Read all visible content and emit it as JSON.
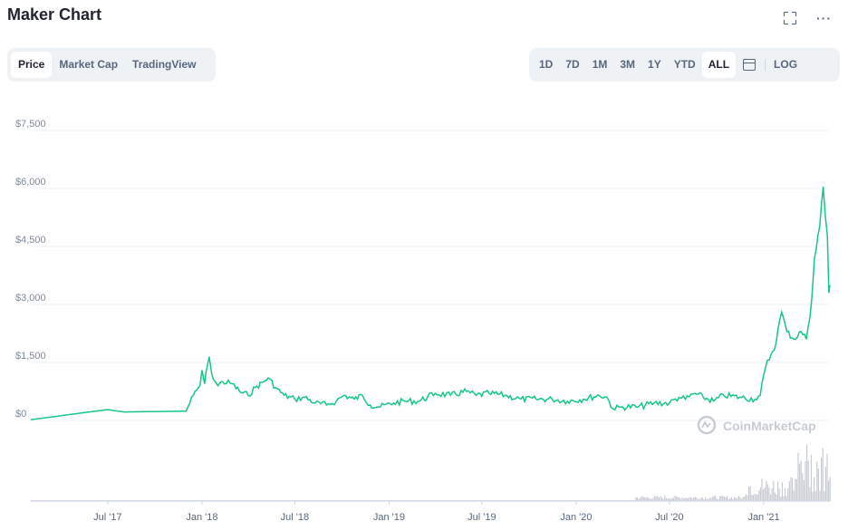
{
  "header": {
    "title": "Maker Chart"
  },
  "icons": {
    "expand": "expand-icon",
    "more": "more-icon",
    "calendar": "calendar-icon"
  },
  "tabs": [
    {
      "label": "Price",
      "active": true
    },
    {
      "label": "Market Cap",
      "active": false
    },
    {
      "label": "TradingView",
      "active": false
    }
  ],
  "ranges": [
    {
      "label": "1D",
      "active": false
    },
    {
      "label": "7D",
      "active": false
    },
    {
      "label": "1M",
      "active": false
    },
    {
      "label": "3M",
      "active": false
    },
    {
      "label": "1Y",
      "active": false
    },
    {
      "label": "YTD",
      "active": false
    },
    {
      "label": "ALL",
      "active": true
    }
  ],
  "log_label": "LOG",
  "watermark": "CoinMarketCap",
  "colors": {
    "line": "#16c784",
    "volume": "#c8ccd3",
    "grid": "#eff2f5"
  },
  "chart_data": {
    "type": "line",
    "title": "Maker Chart",
    "ylim": [
      0,
      7500
    ],
    "yticks": [
      "$7,500",
      "$6,000",
      "$4,500",
      "$3,000",
      "$1,500",
      "$0"
    ],
    "ytick_values": [
      7500,
      6000,
      4500,
      3000,
      1500,
      0
    ],
    "xticks": [
      "Jul '17",
      "Jan '18",
      "Jul '18",
      "Jan '19",
      "Jul '19",
      "Jan '20",
      "Jul '20",
      "Jan '21"
    ],
    "xlim": [
      "2017-02-01",
      "2021-05-10"
    ],
    "series": [
      {
        "points": [
          [
            "2017-02-01",
            20
          ],
          [
            "2017-06-01",
            230
          ],
          [
            "2017-07-01",
            280
          ],
          [
            "2017-08-01",
            220
          ],
          [
            "2017-10-01",
            230
          ],
          [
            "2017-12-01",
            240
          ],
          [
            "2017-12-15",
            650
          ],
          [
            "2017-12-28",
            900
          ],
          [
            "2018-01-01",
            1300
          ],
          [
            "2018-01-06",
            950
          ],
          [
            "2018-01-12",
            1450
          ],
          [
            "2018-01-15",
            1650
          ],
          [
            "2018-01-20",
            1200
          ],
          [
            "2018-02-01",
            900
          ],
          [
            "2018-02-10",
            1000
          ],
          [
            "2018-03-01",
            950
          ],
          [
            "2018-03-15",
            750
          ],
          [
            "2018-04-01",
            650
          ],
          [
            "2018-04-15",
            850
          ],
          [
            "2018-05-01",
            1000
          ],
          [
            "2018-05-10",
            1100
          ],
          [
            "2018-05-25",
            850
          ],
          [
            "2018-06-10",
            650
          ],
          [
            "2018-07-01",
            550
          ],
          [
            "2018-07-20",
            600
          ],
          [
            "2018-08-10",
            450
          ],
          [
            "2018-09-01",
            400
          ],
          [
            "2018-09-20",
            500
          ],
          [
            "2018-10-05",
            650
          ],
          [
            "2018-10-25",
            550
          ],
          [
            "2018-11-10",
            650
          ],
          [
            "2018-11-25",
            400
          ],
          [
            "2018-12-15",
            350
          ],
          [
            "2019-01-10",
            450
          ],
          [
            "2019-02-01",
            500
          ],
          [
            "2019-03-01",
            500
          ],
          [
            "2019-04-01",
            700
          ],
          [
            "2019-05-01",
            650
          ],
          [
            "2019-06-01",
            750
          ],
          [
            "2019-06-20",
            650
          ],
          [
            "2019-07-15",
            700
          ],
          [
            "2019-08-15",
            650
          ],
          [
            "2019-09-15",
            550
          ],
          [
            "2019-10-15",
            550
          ],
          [
            "2019-11-15",
            550
          ],
          [
            "2019-12-15",
            500
          ],
          [
            "2020-01-15",
            550
          ],
          [
            "2020-02-15",
            650
          ],
          [
            "2020-03-01",
            600
          ],
          [
            "2020-03-13",
            300
          ],
          [
            "2020-04-01",
            350
          ],
          [
            "2020-05-01",
            350
          ],
          [
            "2020-06-01",
            450
          ],
          [
            "2020-07-01",
            450
          ],
          [
            "2020-07-20",
            600
          ],
          [
            "2020-08-01",
            550
          ],
          [
            "2020-08-20",
            700
          ],
          [
            "2020-09-05",
            600
          ],
          [
            "2020-09-25",
            500
          ],
          [
            "2020-10-15",
            650
          ],
          [
            "2020-11-15",
            600
          ],
          [
            "2020-12-15",
            550
          ],
          [
            "2020-12-25",
            650
          ],
          [
            "2021-01-05",
            1400
          ],
          [
            "2021-01-15",
            1700
          ],
          [
            "2021-01-25",
            2000
          ],
          [
            "2021-02-01",
            2600
          ],
          [
            "2021-02-05",
            2800
          ],
          [
            "2021-02-15",
            2300
          ],
          [
            "2021-03-01",
            2100
          ],
          [
            "2021-03-15",
            2300
          ],
          [
            "2021-03-25",
            2100
          ],
          [
            "2021-04-05",
            3200
          ],
          [
            "2021-04-10",
            4200
          ],
          [
            "2021-04-20",
            5000
          ],
          [
            "2021-04-27",
            6050
          ],
          [
            "2021-05-01",
            5300
          ],
          [
            "2021-05-05",
            4800
          ],
          [
            "2021-05-08",
            3300
          ],
          [
            "2021-05-10",
            3500
          ]
        ]
      }
    ]
  }
}
